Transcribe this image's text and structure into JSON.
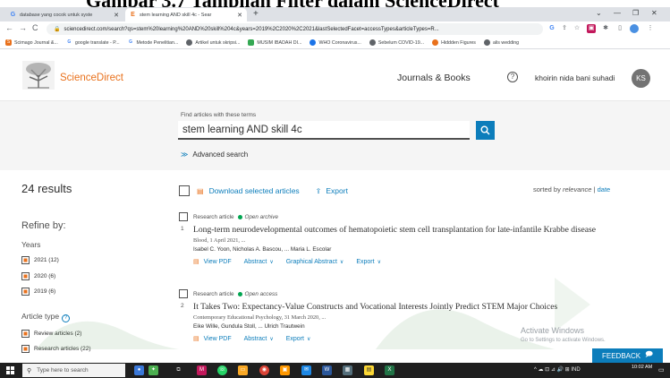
{
  "caption": "Gambar 3.7 Tampilan Filter dalam ScienceDirect",
  "browser": {
    "tabs": [
      {
        "title": "database yang cocok untuk syste",
        "icon": "google-icon",
        "active": false
      },
      {
        "title": "stem learning AND skill 4c - Sear",
        "icon": "elsevier-icon",
        "active": true
      }
    ],
    "url": "sciencedirect.com/search?qs=stem%20learning%20AND%20skill%204c&years=2019%2C2020%2C2021&lastSelectedFacet=accessTypes&articleTypes=R...",
    "bookmarks": [
      {
        "label": "Scimago Journal &...",
        "color": "#e9711c"
      },
      {
        "label": "google translate - P...",
        "color": "#4285f4"
      },
      {
        "label": "Metode Penelitian...",
        "color": "#4285f4"
      },
      {
        "label": "Artikel untuk skripsi...",
        "color": "#5f6368"
      },
      {
        "label": "MUSIM IBADAH DI...",
        "color": "#34a853"
      },
      {
        "label": "WHO Coronavirus...",
        "color": "#1a73e8"
      },
      {
        "label": "Sebelum COVID-19...",
        "color": "#5f6368"
      },
      {
        "label": "Hiddden Figures",
        "color": "#e9711c"
      },
      {
        "label": "alis wedding",
        "color": "#5f6368"
      }
    ]
  },
  "header": {
    "brand": "ScienceDirect",
    "journals_books": "Journals & Books",
    "help": "?",
    "user_name": "khoirin nida bani suhadi",
    "avatar_initials": "KS"
  },
  "search": {
    "label": "Find articles with these terms",
    "value": "stem learning AND skill 4c",
    "advanced": "Advanced search"
  },
  "results": {
    "count": "24 results",
    "download": "Download selected articles",
    "export": "Export",
    "sort_prefix": "sorted by",
    "sort_relevance": "relevance",
    "sort_sep": "|",
    "sort_date": "date"
  },
  "refine": {
    "title": "Refine by:",
    "years_label": "Years",
    "years": [
      "2021 (12)",
      "2020 (6)",
      "2019 (6)"
    ],
    "article_type_label": "Article type",
    "article_types": [
      "Review articles (2)",
      "Research articles (22)"
    ]
  },
  "articles": [
    {
      "num": "1",
      "type": "Research article",
      "access": "Open archive",
      "title": "Long-term neurodevelopmental outcomes of hematopoietic stem cell transplantation for late-infantile Krabbe disease",
      "source": "Blood, 1 April 2021, ...",
      "authors": "Isabel C. Yoon, Nicholas A. Bascou, ... Maria L. Escolar",
      "actions": [
        "View PDF",
        "Abstract",
        "Graphical Abstract",
        "Export"
      ]
    },
    {
      "num": "2",
      "type": "Research article",
      "access": "Open access",
      "title": "It Takes Two: Expectancy-Value Constructs and Vocational Interests Jointly Predict STEM Major Choices",
      "source": "Contemporary Educational Psychology, 31 March 2020, ...",
      "authors": "Eike Wille, Gundula Stoll, ... Ulrich Trautwein",
      "actions": [
        "View PDF",
        "Abstract",
        "Export"
      ]
    }
  ],
  "windows": {
    "activate_title": "Activate Windows",
    "activate_sub": "Go to Settings to activate Windows.",
    "feedback": "FEEDBACK",
    "search_placeholder": "Type here to search",
    "tray": "^ ☁ ⊡ ⊿ 🔊 ⊞ IND",
    "time": "10:02 AM"
  },
  "colors": {
    "brand_orange": "#e9711c",
    "link_blue": "#0c7dbb",
    "open_access_green": "#00a550"
  }
}
